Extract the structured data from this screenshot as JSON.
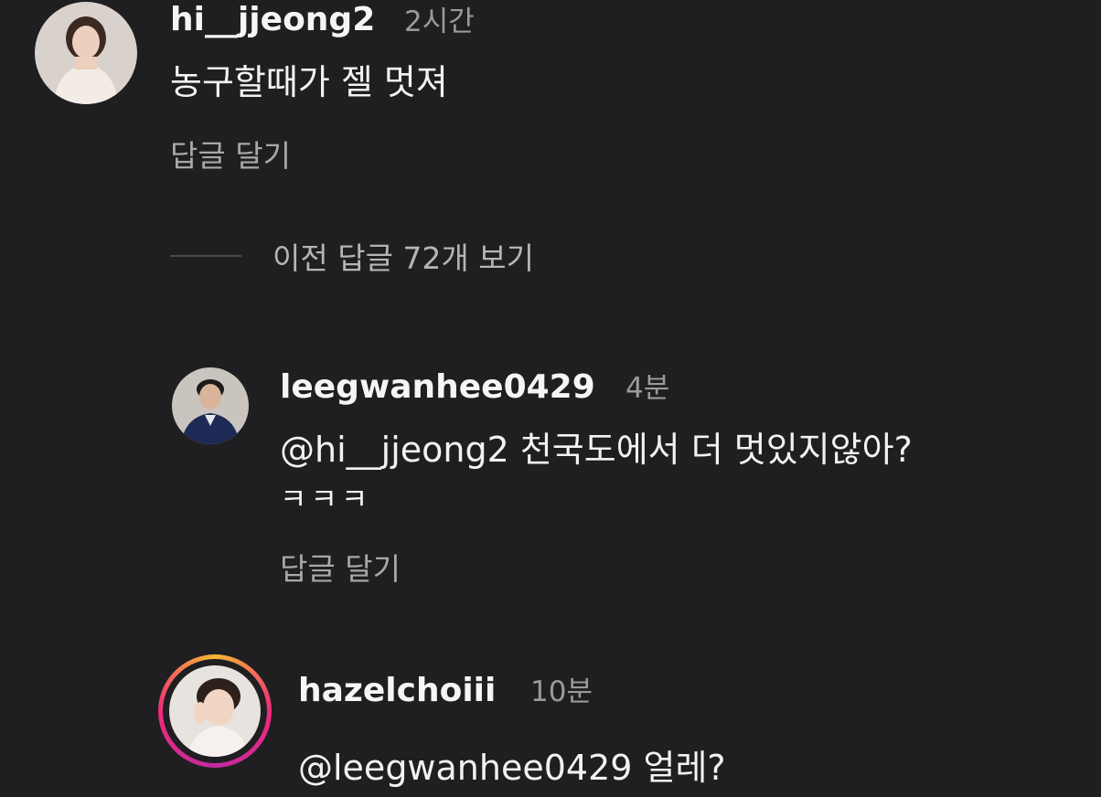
{
  "comments": [
    {
      "username": "hi__jjeong2",
      "time": "2시간",
      "text": "농구할때가 젤 멋져",
      "reply_label": "답글 달기"
    }
  ],
  "view_previous_replies": "이전 답글 72개 보기",
  "replies": [
    {
      "username": "leegwanhee0429",
      "time": "4분",
      "text_line1": "@hi__jjeong2 천국도에서 더 멋있지않아?",
      "text_line2": "ㅋㅋㅋ",
      "reply_label": "답글 달기"
    },
    {
      "username": "hazelchoiii",
      "time": "10분",
      "text": "@leegwanhee0429 얼레?"
    }
  ]
}
